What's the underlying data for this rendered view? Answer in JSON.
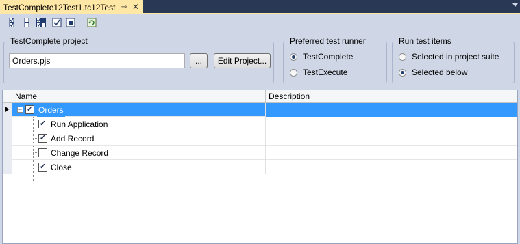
{
  "tab": {
    "title": "TestComplete12Test1.tc12Test",
    "pin_glyph": "⊸",
    "close_glyph": "✕"
  },
  "toolbar": {
    "icons": [
      "check-all-icon",
      "uncheck-all-icon",
      "check-selected-icon",
      "check-icon",
      "uncheck-icon",
      "refresh-icon"
    ]
  },
  "project_group": {
    "label": "TestComplete project",
    "value": "Orders.pjs",
    "browse_label": "...",
    "edit_label": "Edit Project..."
  },
  "runner_group": {
    "label": "Preferred test runner",
    "options": [
      {
        "label": "TestComplete",
        "checked": true
      },
      {
        "label": "TestExecute",
        "checked": false
      }
    ]
  },
  "run_group": {
    "label": "Run test items",
    "options": [
      {
        "label": "Selected in project suite",
        "checked": false
      },
      {
        "label": "Selected below",
        "checked": true
      }
    ]
  },
  "grid": {
    "columns": [
      "Name",
      "Description"
    ],
    "rows": [
      {
        "name": "Orders",
        "checked": true,
        "root": true,
        "description": ""
      },
      {
        "name": "Run Application",
        "checked": true,
        "root": false,
        "description": ""
      },
      {
        "name": "Add Record",
        "checked": true,
        "root": false,
        "description": ""
      },
      {
        "name": "Change Record",
        "checked": false,
        "root": false,
        "description": ""
      },
      {
        "name": "Close",
        "checked": true,
        "root": false,
        "description": ""
      }
    ]
  },
  "colors": {
    "selection": "#3399FF",
    "tab": "#FFE8A6",
    "panel": "#CFD6E5",
    "frame": "#293955"
  }
}
